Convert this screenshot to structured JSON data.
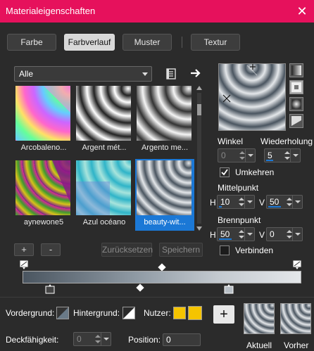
{
  "title": "Materialeigenschaften",
  "tabs": [
    {
      "label": "Farbe",
      "active": false
    },
    {
      "label": "Farbverlauf",
      "active": true
    },
    {
      "label": "Muster",
      "active": false
    },
    {
      "label": "Textur",
      "active": false
    }
  ],
  "category": {
    "value": "Alle"
  },
  "gradients": [
    {
      "label": "Arcobaleno...",
      "selected": false
    },
    {
      "label": "Argent mét...",
      "selected": false
    },
    {
      "label": "Argento me...",
      "selected": false
    },
    {
      "label": "aynewone5",
      "selected": false
    },
    {
      "label": "Azul océano",
      "selected": false
    },
    {
      "label": "beauty-wit...",
      "selected": true
    }
  ],
  "buttons": {
    "add": "+",
    "remove": "-",
    "reset": "Zurücksetzen",
    "save": "Speichern",
    "add_material": "+"
  },
  "angle": {
    "label": "Winkel",
    "value": "0"
  },
  "repeats": {
    "label": "Wiederholung",
    "value": "5"
  },
  "invert": {
    "label": "Umkehren",
    "checked": true
  },
  "center": {
    "label": "Mittelpunkt",
    "h_label": "H",
    "h_value": "10",
    "v_label": "V",
    "v_value": "50"
  },
  "focal": {
    "label": "Brennpunkt",
    "h_label": "H",
    "h_value": "50",
    "v_label": "V",
    "v_value": "0"
  },
  "link": {
    "label": "Verbinden",
    "checked": false
  },
  "bottom": {
    "foreground_label": "Vordergrund:",
    "background_label": "Hintergrund:",
    "user_label": "Nutzer:",
    "opacity_label": "Deckfähigkeit:",
    "opacity_value": "0",
    "position_label": "Position:",
    "position_value": "0",
    "current_label": "Aktuell",
    "previous_label": "Vorher"
  },
  "colors": {
    "accent": "#e6115c",
    "selection": "#1b78d6",
    "user_color": "#f5c400"
  }
}
